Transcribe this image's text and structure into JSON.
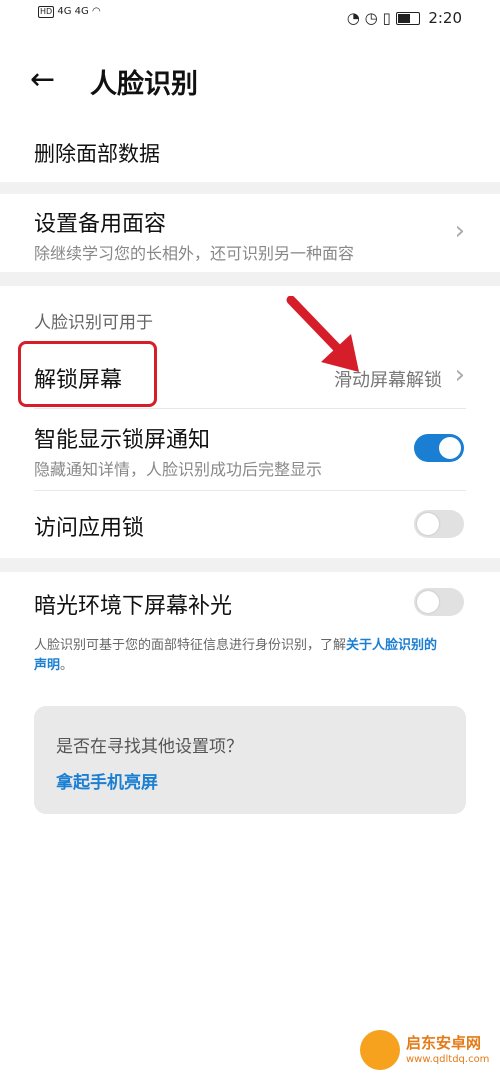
{
  "status_bar": {
    "left_text": "4G 4G",
    "time": "2:20"
  },
  "header": {
    "title": "人脸识别"
  },
  "delete_face": {
    "label": "删除面部数据"
  },
  "backup_face": {
    "title": "设置备用面容",
    "subtitle": "除继续学习您的长相外，还可识别另一种面容"
  },
  "usage": {
    "section_label": "人脸识别可用于",
    "unlock_title": "解锁屏幕",
    "unlock_value": "滑动屏幕解锁",
    "smart_title": "智能显示锁屏通知",
    "smart_subtitle": "隐藏通知详情，人脸识别成功后完整显示",
    "smart_enabled": true,
    "applock_title": "访问应用锁",
    "applock_enabled": false
  },
  "lowlight": {
    "title": "暗光环境下屏幕补光",
    "enabled": false
  },
  "footnote": {
    "text": "人脸识别可基于您的面部特征信息进行身份识别，了解",
    "link": "关于人脸识别的",
    "link2": "声明",
    "end": "。"
  },
  "suggest_card": {
    "question": "是否在寻找其他设置项？",
    "link": "拿起手机亮屏"
  },
  "watermark": {
    "name": "启东安卓网",
    "url": "www.qdltdq.com"
  },
  "colors": {
    "accent": "#1a7fd3",
    "highlight_box": "#d61e2a"
  }
}
